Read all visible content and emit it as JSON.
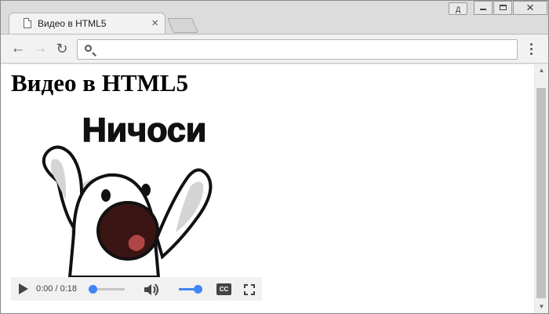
{
  "tab": {
    "title": "Видео в HTML5",
    "close": "×"
  },
  "window": {
    "user_label": "Д"
  },
  "toolbar": {
    "back": "←",
    "forward": "→",
    "reload": "↻",
    "url": ""
  },
  "page": {
    "heading": "Видео в HTML5"
  },
  "video": {
    "overlay_text": "Ничоси",
    "time": "0:00 / 0:18",
    "cc": "CC",
    "progress": 0.0,
    "volume": 1.0
  },
  "scroll": {
    "up": "▲",
    "down": "▼"
  },
  "colors": {
    "accent": "#4285f4",
    "controls_bg": "#f1f1f1"
  },
  "icons": [
    "page-icon",
    "close-icon",
    "new-tab-icon",
    "back-arrow-icon",
    "forward-arrow-icon",
    "reload-icon",
    "search-icon",
    "menu-dots-icon",
    "play-icon",
    "volume-icon",
    "closed-captions-icon",
    "fullscreen-icon"
  ]
}
